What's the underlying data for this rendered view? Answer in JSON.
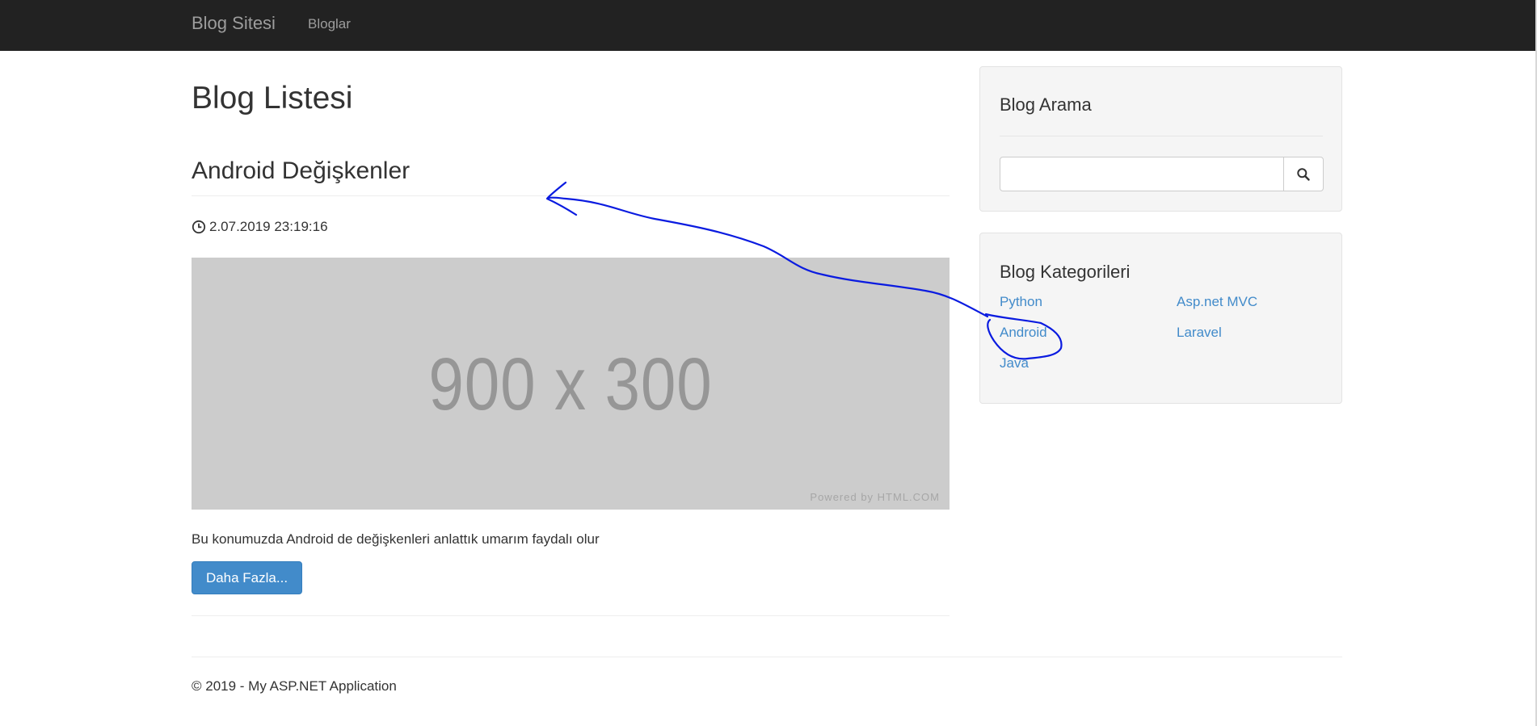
{
  "navbar": {
    "brand": "Blog Sitesi",
    "links": [
      "Bloglar"
    ]
  },
  "main": {
    "page_title": "Blog Listesi",
    "post": {
      "title": "Android Değişkenler",
      "date": "2.07.2019 23:19:16",
      "image_text": "900 x 300",
      "image_credit": "Powered by HTML.COM",
      "excerpt": "Bu konumuzda Android de değişkenleri anlattık umarım faydalı olur",
      "more_button": "Daha Fazla..."
    }
  },
  "sidebar": {
    "search": {
      "title": "Blog Arama",
      "placeholder": "",
      "button_icon": "search-icon"
    },
    "categories": {
      "title": "Blog Kategorileri",
      "items": [
        "Python",
        "Asp.net MVC",
        "Android",
        "Laravel",
        "Java"
      ]
    }
  },
  "footer": {
    "text": "© 2019 - My ASP.NET Application"
  },
  "colors": {
    "navbar_bg": "#222222",
    "link": "#428bca",
    "primary_button": "#428bca",
    "well_bg": "#f5f5f5",
    "annotation_ink": "#0a1be0"
  }
}
